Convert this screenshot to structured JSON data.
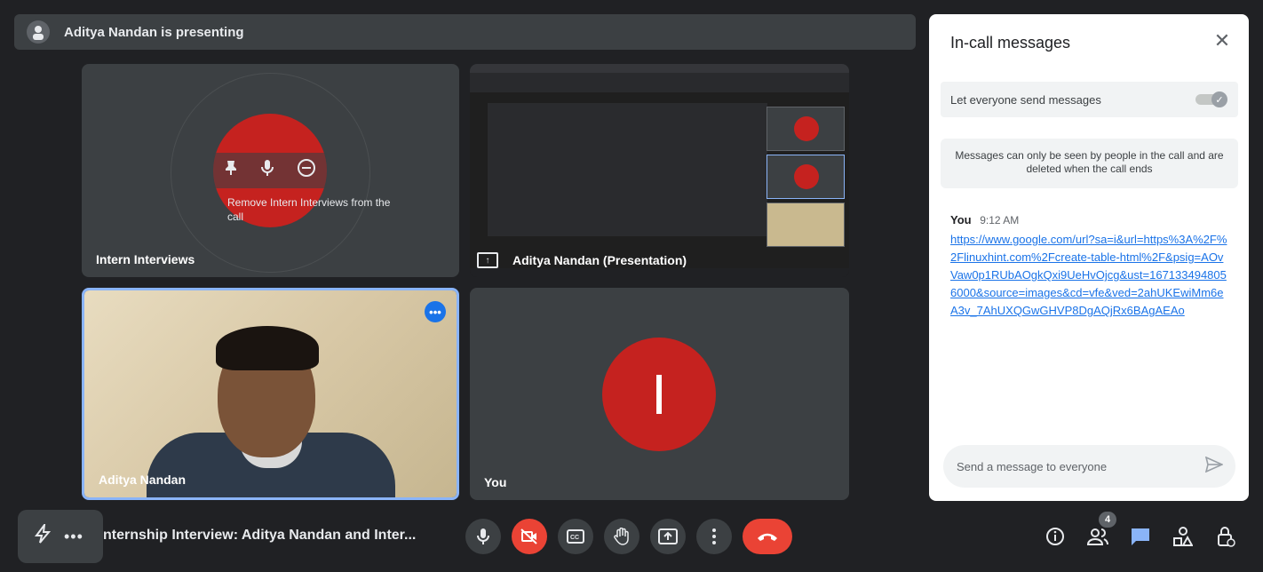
{
  "banner": {
    "text": "Aditya Nandan is presenting"
  },
  "tiles": {
    "intern": {
      "name": "Intern Interviews",
      "tooltip": "Remove Intern Interviews from the call"
    },
    "presentation": {
      "name": "Aditya Nandan (Presentation)"
    },
    "aditya": {
      "name": "Aditya Nandan"
    },
    "you": {
      "name": "You",
      "initial": "I"
    }
  },
  "chat": {
    "title": "In-call messages",
    "toggle_label": "Let everyone send messages",
    "toggle_on": true,
    "info": "Messages can only be seen by people in the call and are deleted when the call ends",
    "messages": [
      {
        "sender": "You",
        "time": "9:12 AM",
        "text": "https://www.google.com/url?sa=i&url=https%3A%2F%2Flinuxhint.com%2Fcreate-table-html%2F&psig=AOvVaw0p1RUbAOgkQxi9UeHvOjcg&ust=1671334948056000&source=images&cd=vfe&ved=2ahUKEwiMm6eA3v_7AhUXQGwGHVP8DgAQjRx6BAgAEAo"
      }
    ],
    "input_placeholder": "Send a message to everyone"
  },
  "bottom": {
    "meeting_title": "nternship Interview: Aditya Nandan and Inter...",
    "people_count": "4"
  },
  "colors": {
    "accent": "#8ab4f8",
    "danger": "#ea4335",
    "avatar": "#c5221f"
  }
}
